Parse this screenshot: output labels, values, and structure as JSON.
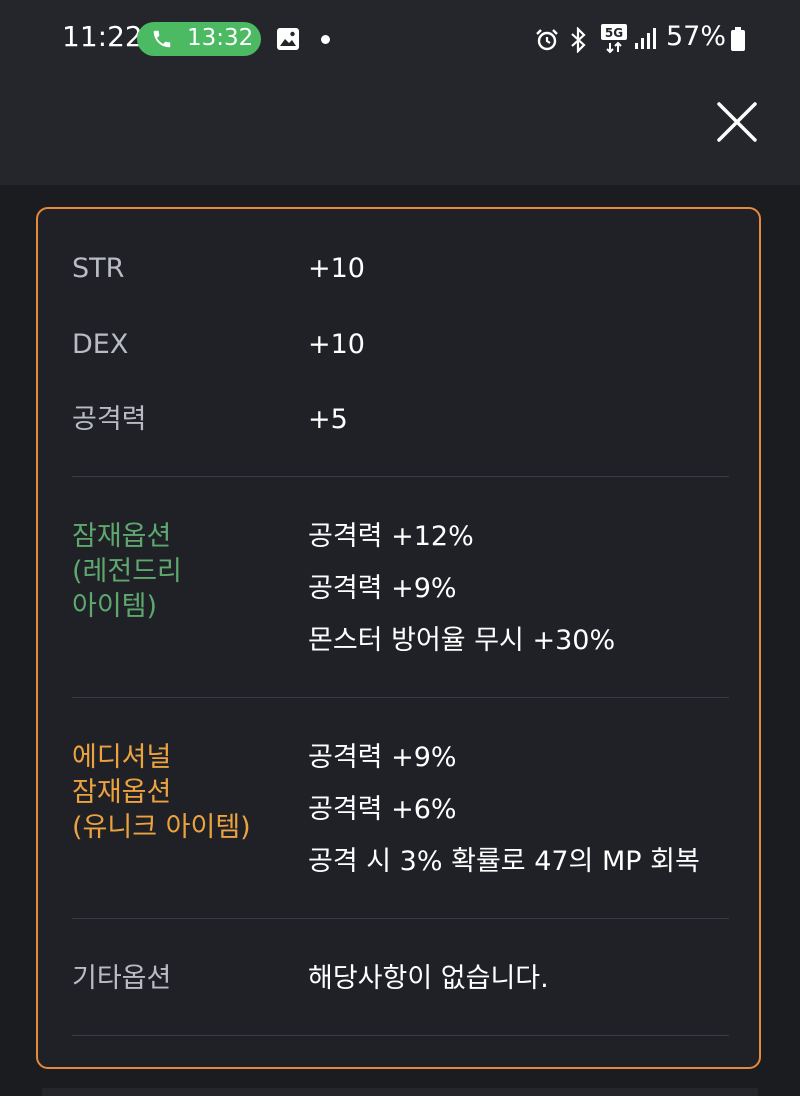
{
  "status_bar": {
    "time": "11:22",
    "call_time": "13:32",
    "battery": "57%",
    "network": "5G",
    "icons": [
      "phone-icon",
      "gallery-icon",
      "alarm-icon",
      "bluetooth-icon",
      "5g-network-icon",
      "signal-icon",
      "battery-icon"
    ]
  },
  "header": {
    "close_icon": "close-icon"
  },
  "colors": {
    "accent_border": "#e58a3c",
    "potential_label": "#5ea86e",
    "additional_label": "#eba23f"
  },
  "stats": [
    {
      "label": "STR",
      "value": "+10"
    },
    {
      "label": "DEX",
      "value": "+10"
    },
    {
      "label": "공격력",
      "value": "+5"
    }
  ],
  "potential": {
    "label": [
      "잠재옵션",
      "(레전드리",
      "아이템)"
    ],
    "values": [
      "공격력 +12%",
      "공격력 +9%",
      "몬스터 방어율 무시 +30%"
    ]
  },
  "additional_potential": {
    "label": [
      "에디셔널",
      "잠재옵션",
      "(유니크 아이템)"
    ],
    "values": [
      "공격력 +9%",
      "공격력 +6%",
      "공격 시 3% 확률로 47의 MP 회복"
    ]
  },
  "other": {
    "label": "기타옵션",
    "value": "해당사항이 없습니다."
  }
}
